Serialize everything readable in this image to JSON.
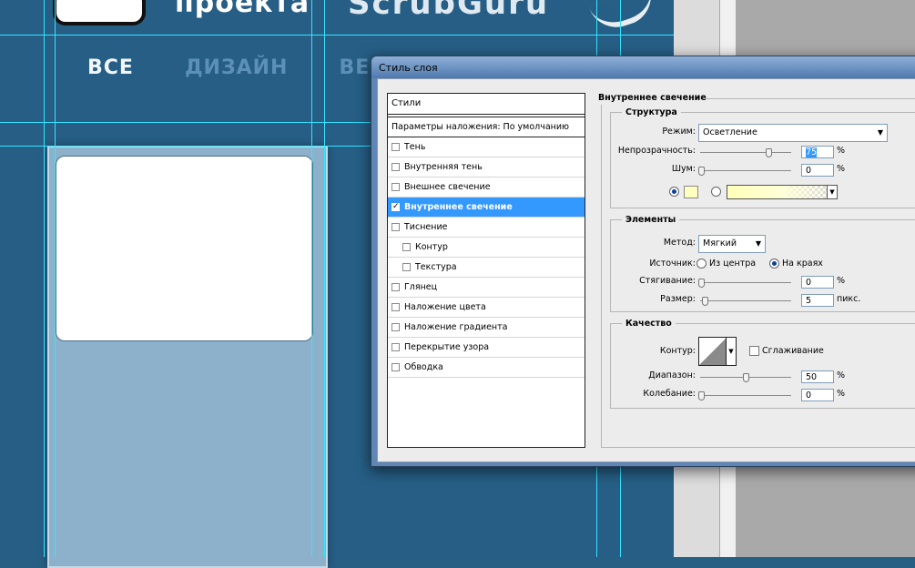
{
  "background": {
    "headline": "проекта",
    "headline2": "ВСЕ",
    "nav": [
      "ВСЕ",
      "ДИЗАЙН",
      "ВЕ"
    ]
  },
  "dialog": {
    "title": "Стиль слоя",
    "styles_header": "Стили",
    "blend_options": "Параметры наложения: По умолчанию",
    "effects": [
      {
        "label": "Тень",
        "checked": false,
        "indent": false,
        "selected": false
      },
      {
        "label": "Внутренняя тень",
        "checked": false,
        "indent": false,
        "selected": false
      },
      {
        "label": "Внешнее свечение",
        "checked": false,
        "indent": false,
        "selected": false
      },
      {
        "label": "Внутреннее свечение",
        "checked": true,
        "indent": false,
        "selected": true
      },
      {
        "label": "Тиснение",
        "checked": false,
        "indent": false,
        "selected": false
      },
      {
        "label": "Контур",
        "checked": false,
        "indent": true,
        "selected": false
      },
      {
        "label": "Текстура",
        "checked": false,
        "indent": true,
        "selected": false
      },
      {
        "label": "Глянец",
        "checked": false,
        "indent": false,
        "selected": false
      },
      {
        "label": "Наложение цвета",
        "checked": false,
        "indent": false,
        "selected": false
      },
      {
        "label": "Наложение градиента",
        "checked": false,
        "indent": false,
        "selected": false
      },
      {
        "label": "Перекрытие узора",
        "checked": false,
        "indent": false,
        "selected": false
      },
      {
        "label": "Обводка",
        "checked": false,
        "indent": false,
        "selected": false
      }
    ],
    "section_title": "Внутреннее свечение",
    "structure": {
      "title": "Структура",
      "mode_label": "Режим:",
      "mode_value": "Осветление",
      "opacity_label": "Непрозрачность:",
      "opacity_value": "75",
      "noise_label": "Шум:",
      "noise_value": "0",
      "percent": "%",
      "glow_color": "#ffffc0"
    },
    "elements": {
      "title": "Элементы",
      "method_label": "Метод:",
      "method_value": "Мягкий",
      "source_label": "Источник:",
      "source_center": "Из центра",
      "source_edge": "На краях",
      "source_selected": "edge",
      "choke_label": "Стягивание:",
      "choke_value": "0",
      "size_label": "Размер:",
      "size_value": "5",
      "size_unit": "пикс.",
      "percent": "%"
    },
    "quality": {
      "title": "Качество",
      "contour_label": "Контур:",
      "antialias_label": "Сглаживание",
      "range_label": "Диапазон:",
      "range_value": "50",
      "jitter_label": "Колебание:",
      "jitter_value": "0",
      "percent": "%"
    }
  }
}
